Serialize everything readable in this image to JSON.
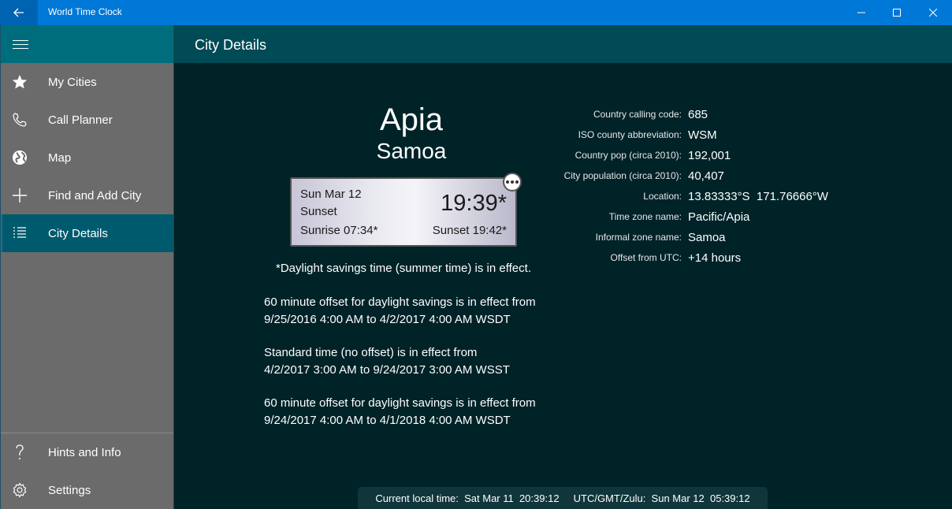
{
  "window": {
    "title": "World Time Clock"
  },
  "header": {
    "title": "City Details"
  },
  "sidebar": {
    "items": [
      {
        "label": "My Cities",
        "icon": "star-icon"
      },
      {
        "label": "Call Planner",
        "icon": "phone-icon"
      },
      {
        "label": "Map",
        "icon": "globe-icon"
      },
      {
        "label": "Find and Add City",
        "icon": "plus-icon"
      },
      {
        "label": "City Details",
        "icon": "list-icon",
        "selected": true
      }
    ],
    "bottom_items": [
      {
        "label": "Hints and Info",
        "icon": "question-icon"
      },
      {
        "label": "Settings",
        "icon": "gear-icon"
      }
    ]
  },
  "city": {
    "name": "Apia",
    "country": "Samoa",
    "clock": {
      "date": "Sun Mar 12",
      "phase": "Sunset",
      "time": "19:39*",
      "sunrise": "Sunrise  07:34*",
      "sunset": "Sunset  19:42*"
    },
    "dst_note": "*Daylight savings time (summer time) is in effect.",
    "periods": [
      {
        "line1": "60 minute offset for daylight savings is in effect from",
        "line2": "9/25/2016 4:00 AM to 4/2/2017 4:00 AM WSDT"
      },
      {
        "line1": "Standard time (no offset) is in effect from",
        "line2": "4/2/2017 3:00 AM to 9/24/2017 3:00 AM WSST"
      },
      {
        "line1": "60 minute offset for daylight savings is in effect from",
        "line2": "9/24/2017 4:00 AM to 4/1/2018 4:00 AM WSDT"
      }
    ]
  },
  "info": [
    {
      "key": "Country calling code:",
      "value": "685"
    },
    {
      "key": "ISO county abbreviation:",
      "value": "WSM"
    },
    {
      "key": "Country pop (circa 2010):",
      "value": "192,001"
    },
    {
      "key": "City population (circa 2010):",
      "value": "40,407"
    },
    {
      "key": "Location:",
      "value": "13.83333°S  171.76666°W"
    },
    {
      "key": "Time zone name:",
      "value": "Pacific/Apia"
    },
    {
      "key": "Informal zone name:",
      "value": "Samoa"
    },
    {
      "key": "Offset from UTC:",
      "value": "+14 hours"
    }
  ],
  "status_bar": {
    "text": "Current local time:  Sat Mar 11  20:39:12     UTC/GMT/Zulu:  Sun Mar 12  05:39:12"
  }
}
